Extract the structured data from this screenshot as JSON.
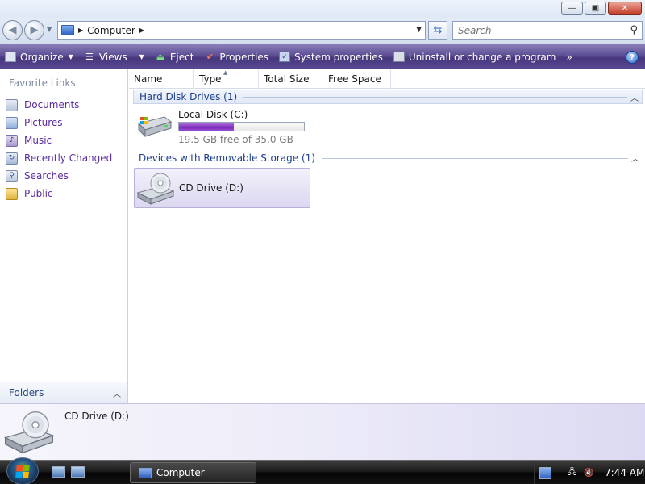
{
  "window": {
    "minimize": "—",
    "maximize": "▣",
    "close": "✕"
  },
  "address": {
    "path": "Computer",
    "search_placeholder": "Search"
  },
  "toolbar": {
    "organize": "Organize",
    "views": "Views",
    "eject": "Eject",
    "properties": "Properties",
    "system_properties": "System properties",
    "uninstall": "Uninstall or change a program",
    "more": "»",
    "help": "?"
  },
  "sidebar": {
    "title": "Favorite Links",
    "items": [
      {
        "label": "Documents",
        "icon": "documents-icon"
      },
      {
        "label": "Pictures",
        "icon": "pictures-icon"
      },
      {
        "label": "Music",
        "icon": "music-icon"
      },
      {
        "label": "Recently Changed",
        "icon": "recently-changed-icon"
      },
      {
        "label": "Searches",
        "icon": "searches-icon"
      },
      {
        "label": "Public",
        "icon": "public-folder-icon"
      }
    ],
    "folders_label": "Folders"
  },
  "columns": [
    "Name",
    "Type",
    "Total Size",
    "Free Space"
  ],
  "groups": {
    "hard_disks": "Hard Disk Drives (1)",
    "removable": "Devices with Removable Storage (1)"
  },
  "drives": {
    "c": {
      "name": "Local Disk (C:)",
      "free_text": "19.5 GB free of 35.0 GB",
      "used_fraction": 0.44
    },
    "d": {
      "name": "CD Drive (D:)"
    }
  },
  "details": {
    "name": "CD Drive (D:)"
  },
  "taskbar": {
    "active_window": "Computer",
    "clock": "7:44 AM"
  },
  "colors": {
    "command_bar": "#4f3f88",
    "link": "#5b2d9c",
    "group_header": "#1c3e8c",
    "usage_fill": "#8a3bc8"
  }
}
